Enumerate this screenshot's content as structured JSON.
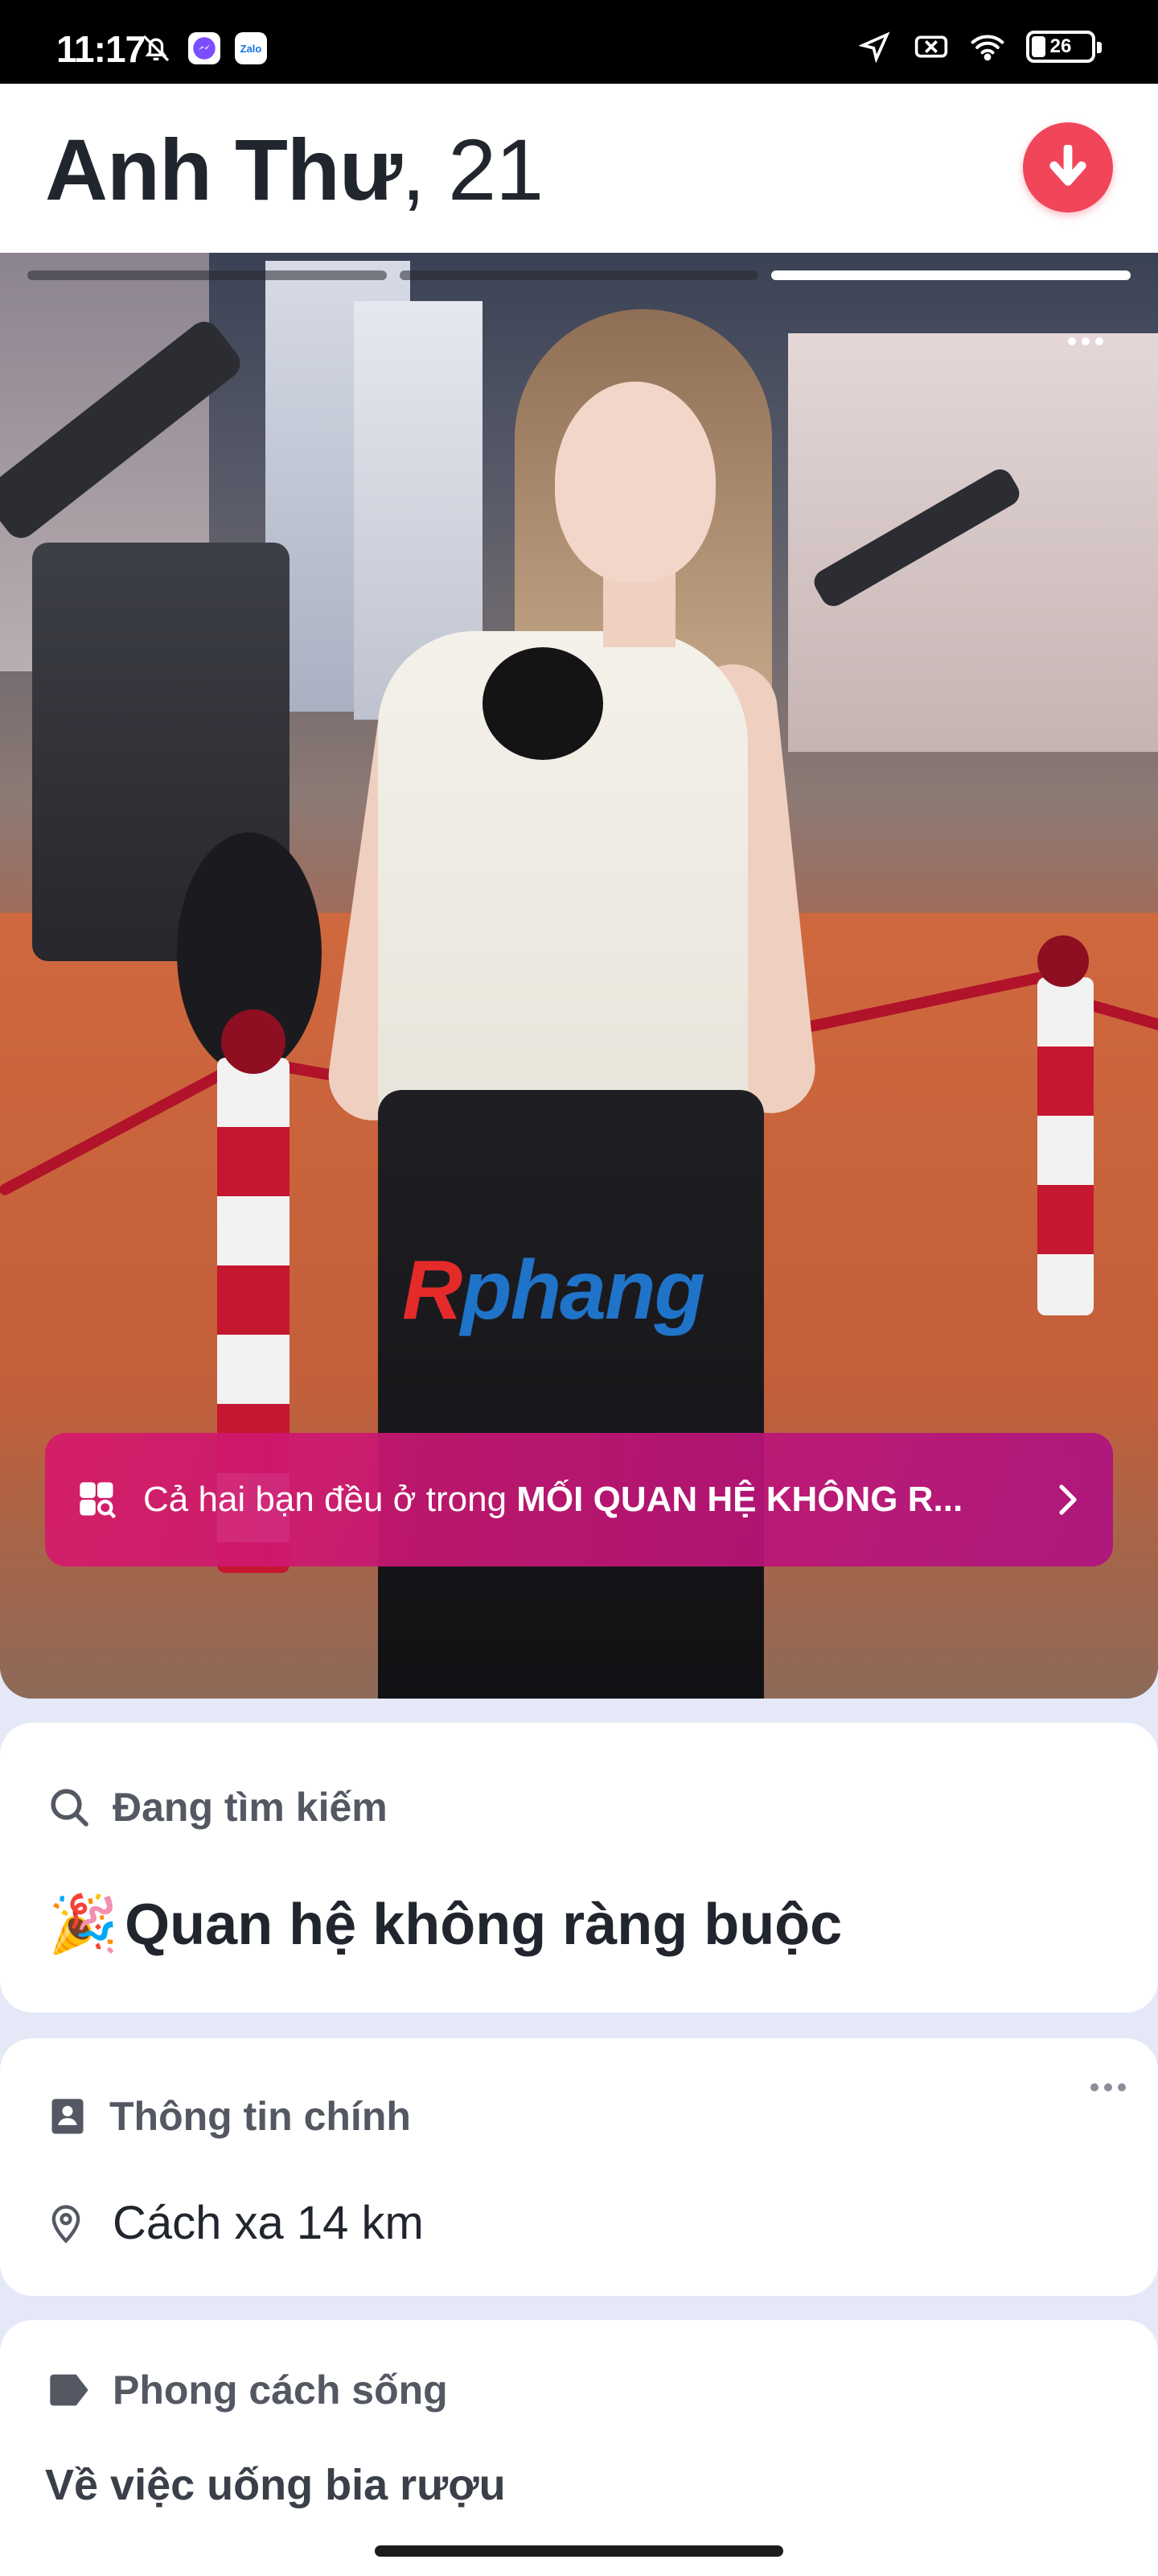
{
  "status_bar": {
    "time": "11:17",
    "app_badge_zalo": "Zalo",
    "battery_level": "26",
    "left_icons": [
      "notifications-off-icon",
      "messenger-icon",
      "zalo-icon"
    ],
    "right_icons": [
      "location-icon",
      "no-sim-icon",
      "wifi-icon",
      "battery-icon"
    ]
  },
  "profile": {
    "name": "Anh Thư",
    "name_sep": ", ",
    "age": "21",
    "photo_index": 3,
    "photo_count": 3
  },
  "photo": {
    "watermark_part1": "R",
    "watermark_part2": "phang"
  },
  "relationship_banner": {
    "text_prefix": "Cả hai bạn đều ở trong ",
    "text_bold": "MỐI QUAN HỆ KHÔNG R..."
  },
  "looking_for": {
    "title": "Đang tìm kiếm",
    "emoji": "🎉",
    "value": "Quan hệ không ràng buộc"
  },
  "basic_info": {
    "title": "Thông tin chính",
    "distance": "Cách xa 14 km"
  },
  "lifestyle": {
    "title": "Phong cách sống",
    "subtitle": "Về việc uống bia rượu"
  },
  "colors": {
    "accent_red": "#f1455a",
    "banner_pink": "#d6196b",
    "background": "#e4e8f7"
  }
}
